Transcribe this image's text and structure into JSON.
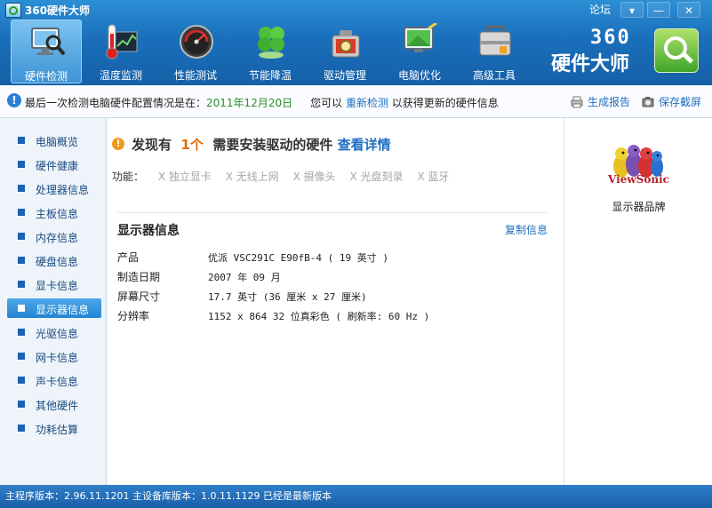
{
  "window": {
    "title": "360硬件大师",
    "forum": "论坛",
    "min": "▾",
    "minimize": "—",
    "close": "✕"
  },
  "nav": [
    {
      "label": "硬件检测",
      "icon": "monitor-magnifier-icon",
      "active": true
    },
    {
      "label": "温度监测",
      "icon": "thermometer-icon"
    },
    {
      "label": "性能测试",
      "icon": "speedometer-icon"
    },
    {
      "label": "节能降温",
      "icon": "clover-icon"
    },
    {
      "label": "驱动管理",
      "icon": "gear-toolbox-icon"
    },
    {
      "label": "电脑优化",
      "icon": "monitor-broom-icon"
    },
    {
      "label": "高级工具",
      "icon": "toolbox-icon"
    }
  ],
  "brand": {
    "num": "360",
    "name": "硬件大师"
  },
  "infobar": {
    "prefix": "最后一次检测电脑硬件配置情况是在：",
    "date": "2011年12月20日",
    "can": "您可以",
    "recheck": "重新检测",
    "suffix": "以获得更新的硬件信息",
    "report": "生成报告",
    "save": "保存截屏"
  },
  "sidebar": [
    {
      "label": "电脑概览"
    },
    {
      "label": "硬件健康"
    },
    {
      "label": "处理器信息"
    },
    {
      "label": "主板信息"
    },
    {
      "label": "内存信息"
    },
    {
      "label": "硬盘信息"
    },
    {
      "label": "显卡信息"
    },
    {
      "label": "显示器信息",
      "active": true
    },
    {
      "label": "光驱信息"
    },
    {
      "label": "网卡信息"
    },
    {
      "label": "声卡信息"
    },
    {
      "label": "其他硬件"
    },
    {
      "label": "功耗估算"
    }
  ],
  "main": {
    "found_prefix": "发现有",
    "found_count": "1个",
    "found_suffix": "需要安装驱动的硬件",
    "found_detail": "查看详情",
    "features_label": "功能：",
    "features": [
      "X 独立显卡",
      "X 无线上网",
      "X 摄像头",
      "X 光盘刻录",
      "X 蓝牙"
    ],
    "section_title": "显示器信息",
    "copy": "复制信息",
    "rows": [
      {
        "label": "产品",
        "value": "优派 VSC291C E90fB-4 ( 19 英寸 )"
      },
      {
        "label": "制造日期",
        "value": "2007 年 09 月"
      },
      {
        "label": "屏幕尺寸",
        "value": "17.7 英寸 (36 厘米 x 27 厘米)"
      },
      {
        "label": "分辨率",
        "value": "1152 x 864 32 位真彩色 ( 刷新率: 60 Hz )"
      }
    ]
  },
  "right": {
    "logo_text": "ViewSonic",
    "caption": "显示器品牌"
  },
  "status": {
    "text": "主程序版本：2.96.11.1201  主设备库版本：1.0.11.1129  已经是最新版本"
  }
}
